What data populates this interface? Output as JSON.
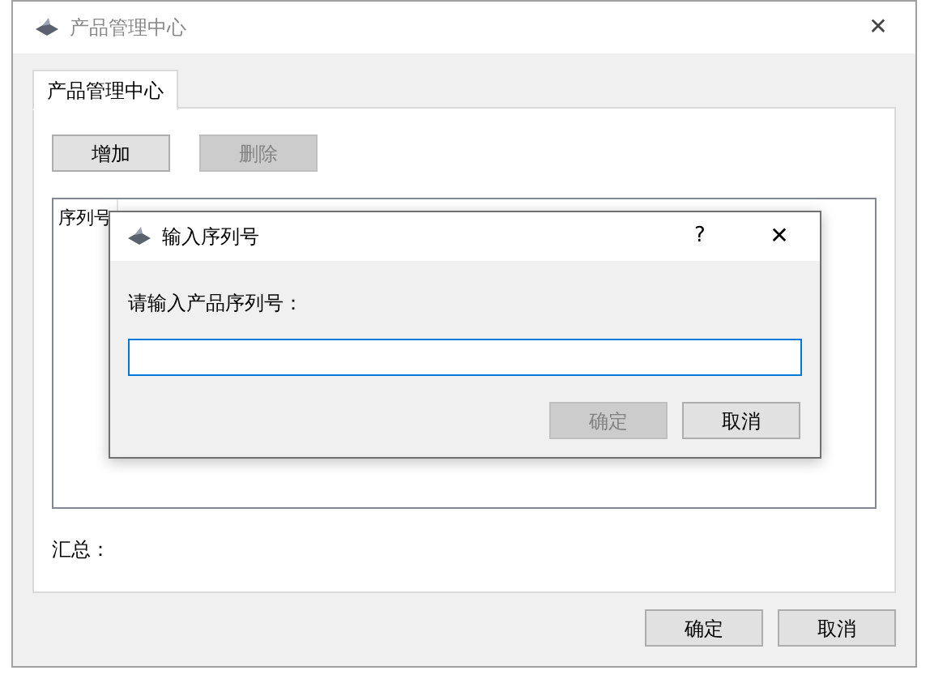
{
  "window": {
    "title": "产品管理中心",
    "close": "✕"
  },
  "tabs": [
    {
      "label": "产品管理中心",
      "selected": true
    }
  ],
  "toolbar": [
    {
      "label": "增加",
      "disabled": false
    },
    {
      "label": "删除",
      "disabled": true
    }
  ],
  "list": {
    "columns": [
      "序列号"
    ]
  },
  "summary": {
    "label": "汇总："
  },
  "footer_buttons": [
    {
      "label": "确定",
      "disabled": false
    },
    {
      "label": "取消",
      "disabled": false
    }
  ],
  "dialog": {
    "title": "输入序列号",
    "help": "?",
    "close": "✕",
    "prompt": "请输入产品序列号：",
    "field": {
      "focused": true
    },
    "buttons": [
      {
        "label": "确定",
        "disabled": true
      },
      {
        "label": "取消",
        "disabled": false
      }
    ]
  }
}
